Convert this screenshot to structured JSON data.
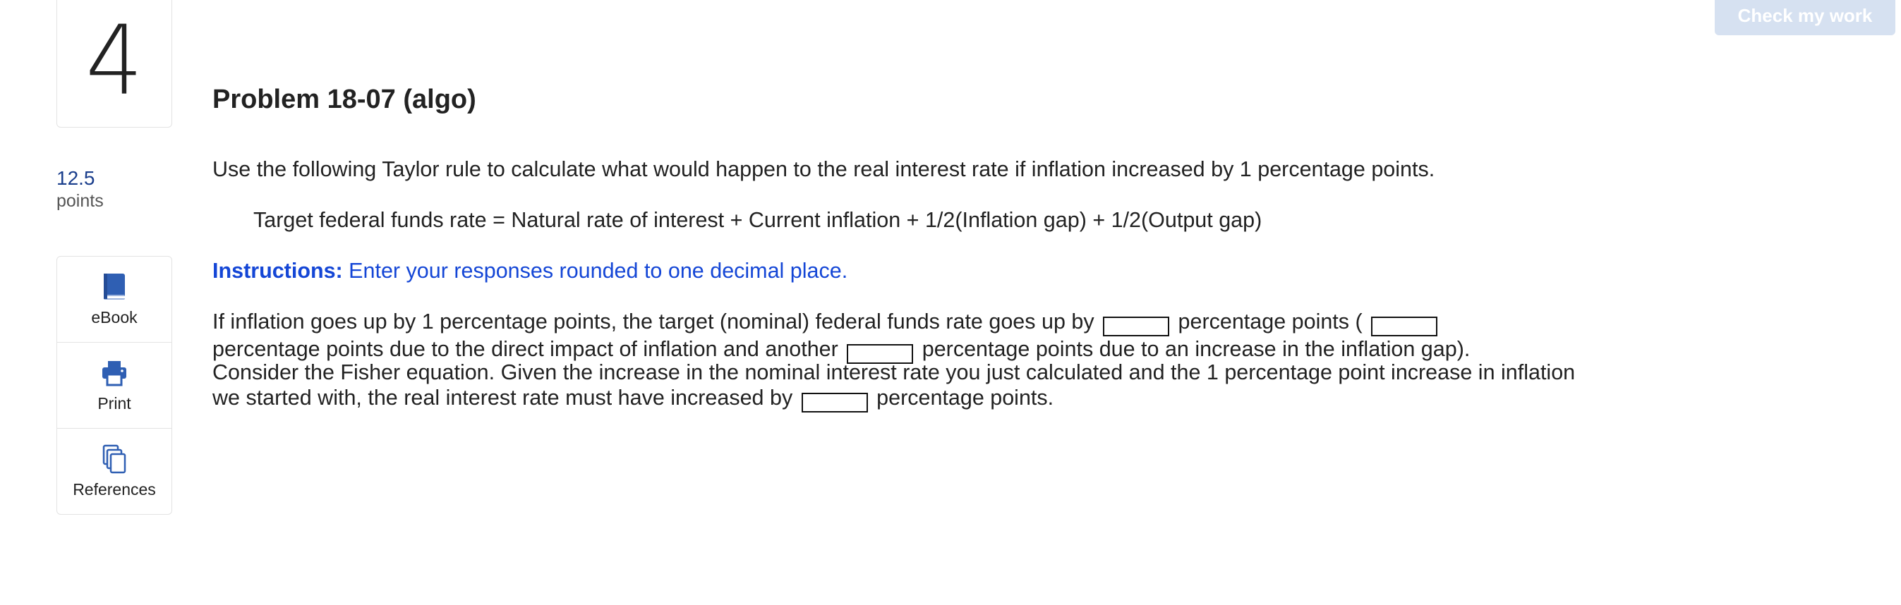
{
  "question": {
    "number": "4",
    "points_value": "12.5",
    "points_label": "points"
  },
  "tools": [
    {
      "label": "eBook",
      "icon": "book-icon"
    },
    {
      "label": "Print",
      "icon": "printer-icon"
    },
    {
      "label": "References",
      "icon": "copy-icon"
    }
  ],
  "header": {
    "check_button_label": "Check my work"
  },
  "problem": {
    "title": "Problem 18-07 (algo)",
    "intro": "Use the following Taylor rule to calculate what would happen to the real interest rate if inflation increased by 1 percentage points.",
    "formula": "Target federal funds rate = Natural rate of interest + Current inflation + 1/2(Inflation gap) + 1/2(Output gap)",
    "instructions_label": "Instructions:",
    "instructions_text": " Enter your responses rounded to one decimal place.",
    "q1_part1": "If inflation goes up by 1 percentage points, the target (nominal) federal funds rate goes up by ",
    "q1_part2": " percentage points ( ",
    "q1_part3": " percentage points due to the direct impact of inflation and another ",
    "q1_part4": " percentage points due to an increase in the inflation gap).",
    "q2_part1": "Consider the Fisher equation.  Given the increase in the nominal interest rate you just calculated and the 1 percentage point increase in inflation we started with, the real interest rate must have increased by ",
    "q2_part2": " percentage points.",
    "answers": {
      "ffr_increase": "",
      "direct_inflation": "",
      "inflation_gap": "",
      "real_rate_increase": ""
    }
  },
  "colors": {
    "accent_blue": "#1446d6",
    "points_blue": "#1a3e8c",
    "icon_blue": "#2f5fb3",
    "button_bg": "#d6e1f1"
  }
}
